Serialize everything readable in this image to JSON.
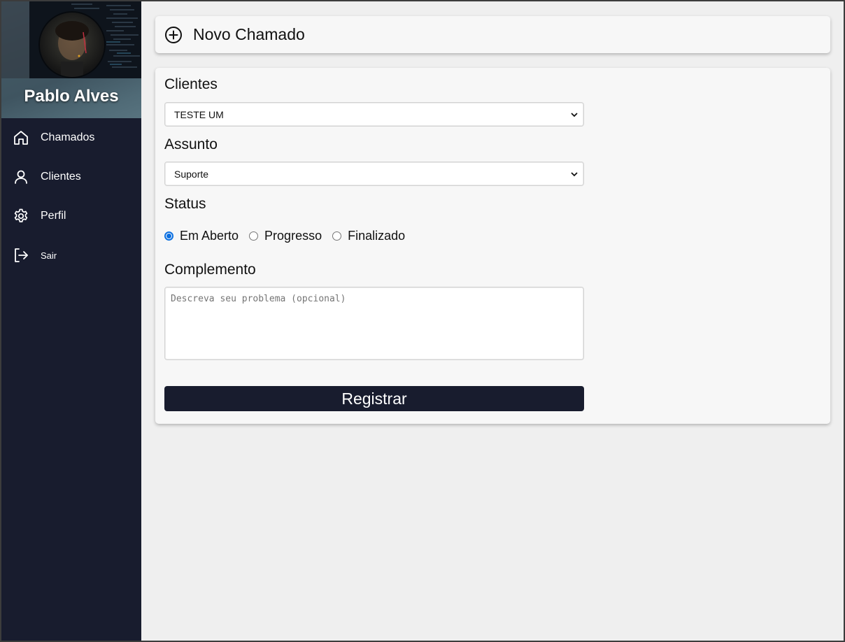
{
  "sidebar": {
    "user_name": "Pablo Alves",
    "items": [
      {
        "label": "Chamados",
        "icon": "home-icon"
      },
      {
        "label": "Clientes",
        "icon": "user-icon"
      },
      {
        "label": "Perfil",
        "icon": "gear-icon"
      },
      {
        "label": "Sair",
        "icon": "logout-icon"
      }
    ]
  },
  "header": {
    "title": "Novo Chamado",
    "icon": "plus-circle-icon"
  },
  "form": {
    "clientes": {
      "label": "Clientes",
      "value": "TESTE UM"
    },
    "assunto": {
      "label": "Assunto",
      "value": "Suporte"
    },
    "status": {
      "label": "Status",
      "options": [
        "Em Aberto",
        "Progresso",
        "Finalizado"
      ],
      "selected": "Em Aberto"
    },
    "complemento": {
      "label": "Complemento",
      "placeholder": "Descreva seu problema (opcional)"
    },
    "submit_label": "Registrar"
  },
  "colors": {
    "sidebar_bg": "#181c2e",
    "accent": "#0b6fe0",
    "page_bg": "#efefef",
    "card_bg": "#f7f7f7"
  }
}
